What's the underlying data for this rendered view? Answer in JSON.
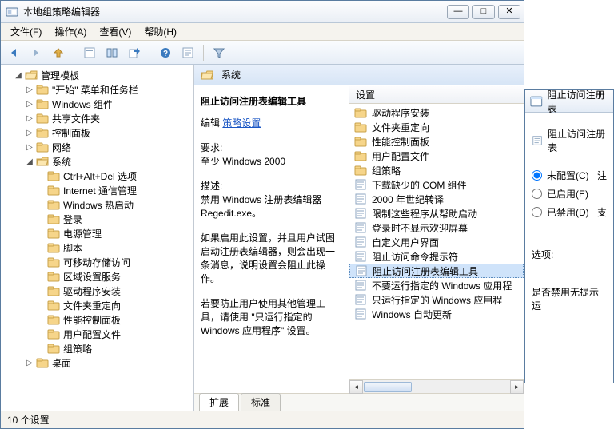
{
  "window": {
    "title": "本地组策略编辑器",
    "btn_min": "—",
    "btn_max": "□",
    "btn_close": "✕"
  },
  "menu": {
    "file": "文件(F)",
    "action": "操作(A)",
    "view": "查看(V)",
    "help": "帮助(H)"
  },
  "tree": {
    "root": "管理模板",
    "items": [
      "\"开始\" 菜单和任务栏",
      "Windows 组件",
      "共享文件夹",
      "控制面板",
      "网络",
      "系统",
      "桌面"
    ],
    "system_children": [
      "Ctrl+Alt+Del 选项",
      "Internet 通信管理",
      "Windows 热启动",
      "登录",
      "电源管理",
      "脚本",
      "可移动存储访问",
      "区域设置服务",
      "驱动程序安装",
      "文件夹重定向",
      "性能控制面板",
      "用户配置文件",
      "组策略"
    ]
  },
  "path": {
    "label": "系统"
  },
  "desc": {
    "title": "阻止访问注册表编辑工具",
    "edit_label": "编辑",
    "edit_link": "策略设置",
    "req_label": "要求:",
    "req_value": "至少 Windows 2000",
    "desc_label": "描述:",
    "desc_p1": "禁用 Windows 注册表编辑器 Regedit.exe。",
    "desc_p2": "如果启用此设置，并且用户试图启动注册表编辑器，则会出现一条消息，说明设置会阻止此操作。",
    "desc_p3": "若要防止用户使用其他管理工具，请使用 \"只运行指定的 Windows 应用程序\" 设置。"
  },
  "list": {
    "col_setting": "设置",
    "items": [
      {
        "icon": "folder",
        "label": "驱动程序安装"
      },
      {
        "icon": "folder",
        "label": "文件夹重定向"
      },
      {
        "icon": "folder",
        "label": "性能控制面板"
      },
      {
        "icon": "folder",
        "label": "用户配置文件"
      },
      {
        "icon": "folder",
        "label": "组策略"
      },
      {
        "icon": "policy",
        "label": "下载缺少的 COM 组件"
      },
      {
        "icon": "policy",
        "label": "2000 年世纪转译"
      },
      {
        "icon": "policy",
        "label": "限制这些程序从帮助启动"
      },
      {
        "icon": "policy",
        "label": "登录时不显示欢迎屏幕"
      },
      {
        "icon": "policy",
        "label": "自定义用户界面"
      },
      {
        "icon": "policy",
        "label": "阻止访问命令提示符"
      },
      {
        "icon": "policy",
        "label": "阻止访问注册表编辑工具",
        "sel": true
      },
      {
        "icon": "policy",
        "label": "不要运行指定的 Windows 应用程"
      },
      {
        "icon": "policy",
        "label": "只运行指定的 Windows 应用程"
      },
      {
        "icon": "policy",
        "label": "Windows 自动更新"
      }
    ]
  },
  "tabs": {
    "ext": "扩展",
    "std": "标准"
  },
  "status": {
    "text": "10 个设置"
  },
  "dialog": {
    "title": "阻止访问注册表",
    "row_label": "阻止访问注册表",
    "not_configured": "未配置(C)",
    "enabled": "已启用(E)",
    "disabled": "已禁用(D)",
    "right_hint1": "注",
    "right_hint2": "支",
    "options_label": "选项:",
    "option_text": "是否禁用无提示运"
  }
}
